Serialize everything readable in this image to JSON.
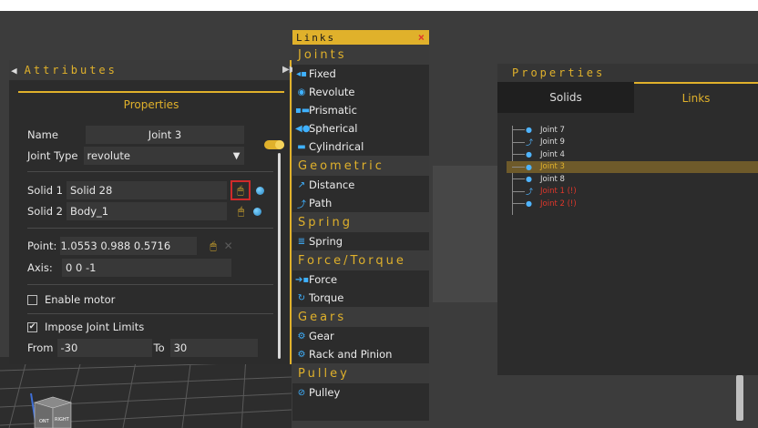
{
  "colors": {
    "accent": "#e0b12b",
    "panel": "#2c2c2c",
    "error": "#e0372b",
    "link_icon": "#3fb1ff",
    "highlight": "#6e5a2a"
  },
  "attributes": {
    "title": "Attributes",
    "collapse_icon": "triangle-left-icon",
    "properties_tab": "Properties",
    "name_label": "Name",
    "name_value": "Joint 3",
    "joint_type_label": "Joint Type",
    "joint_type_value": "revolute",
    "solid1_label": "Solid 1",
    "solid1_value": "Solid 28",
    "solid2_label": "Solid 2",
    "solid2_value": "Body_1",
    "point_label": "Point:",
    "point_value": "1.0553 0.988 0.5716",
    "axis_label": "Axis:",
    "axis_value": "0 0 -1",
    "enable_motor_label": "Enable motor",
    "enable_motor_checked": false,
    "impose_limits_label": "Impose Joint Limits",
    "impose_limits_checked": true,
    "from_label": "From",
    "from_value": "-30",
    "to_label": "To",
    "to_value": "30"
  },
  "links_menu": {
    "title": "Links",
    "close_glyph": "×",
    "categories": [
      {
        "name": "Joints",
        "items": [
          {
            "label": "Fixed",
            "icon": "fixed-icon"
          },
          {
            "label": "Revolute",
            "icon": "revolute-icon"
          },
          {
            "label": "Prismatic",
            "icon": "prismatic-icon"
          },
          {
            "label": "Spherical",
            "icon": "spherical-icon"
          },
          {
            "label": "Cylindrical",
            "icon": "cylindrical-icon"
          }
        ]
      },
      {
        "name": "Geometric",
        "items": [
          {
            "label": "Distance",
            "icon": "distance-icon"
          },
          {
            "label": "Path",
            "icon": "path-icon"
          }
        ]
      },
      {
        "name": "Spring",
        "items": [
          {
            "label": "Spring",
            "icon": "spring-icon"
          }
        ]
      },
      {
        "name": "Force/Torque",
        "items": [
          {
            "label": "Force",
            "icon": "force-icon"
          },
          {
            "label": "Torque",
            "icon": "torque-icon"
          }
        ]
      },
      {
        "name": "Gears",
        "items": [
          {
            "label": "Gear",
            "icon": "gear-icon"
          },
          {
            "label": "Rack and Pinion",
            "icon": "rack-pinion-icon"
          }
        ]
      },
      {
        "name": "Pulley",
        "items": [
          {
            "label": "Pulley",
            "icon": "pulley-icon"
          }
        ]
      }
    ]
  },
  "properties": {
    "title": "Properties",
    "tabs": [
      "Solids",
      "Links"
    ],
    "active_tab": "Links",
    "tree": [
      {
        "label": "Joint 7",
        "icon": "joint-icon",
        "state": "normal"
      },
      {
        "label": "Joint 9",
        "icon": "path-icon",
        "state": "normal"
      },
      {
        "label": "Joint 4",
        "icon": "joint-icon",
        "state": "normal"
      },
      {
        "label": "Joint 3",
        "icon": "joint-icon",
        "state": "selected"
      },
      {
        "label": "Joint 8",
        "icon": "joint-icon",
        "state": "normal"
      },
      {
        "label": "Joint 1 (!)",
        "icon": "path-icon",
        "state": "error"
      },
      {
        "label": "Joint 2 (!)",
        "icon": "joint-icon",
        "state": "error"
      }
    ]
  },
  "viewcube": {
    "faces": [
      "TOP",
      "RIGHT",
      "ONT"
    ]
  }
}
